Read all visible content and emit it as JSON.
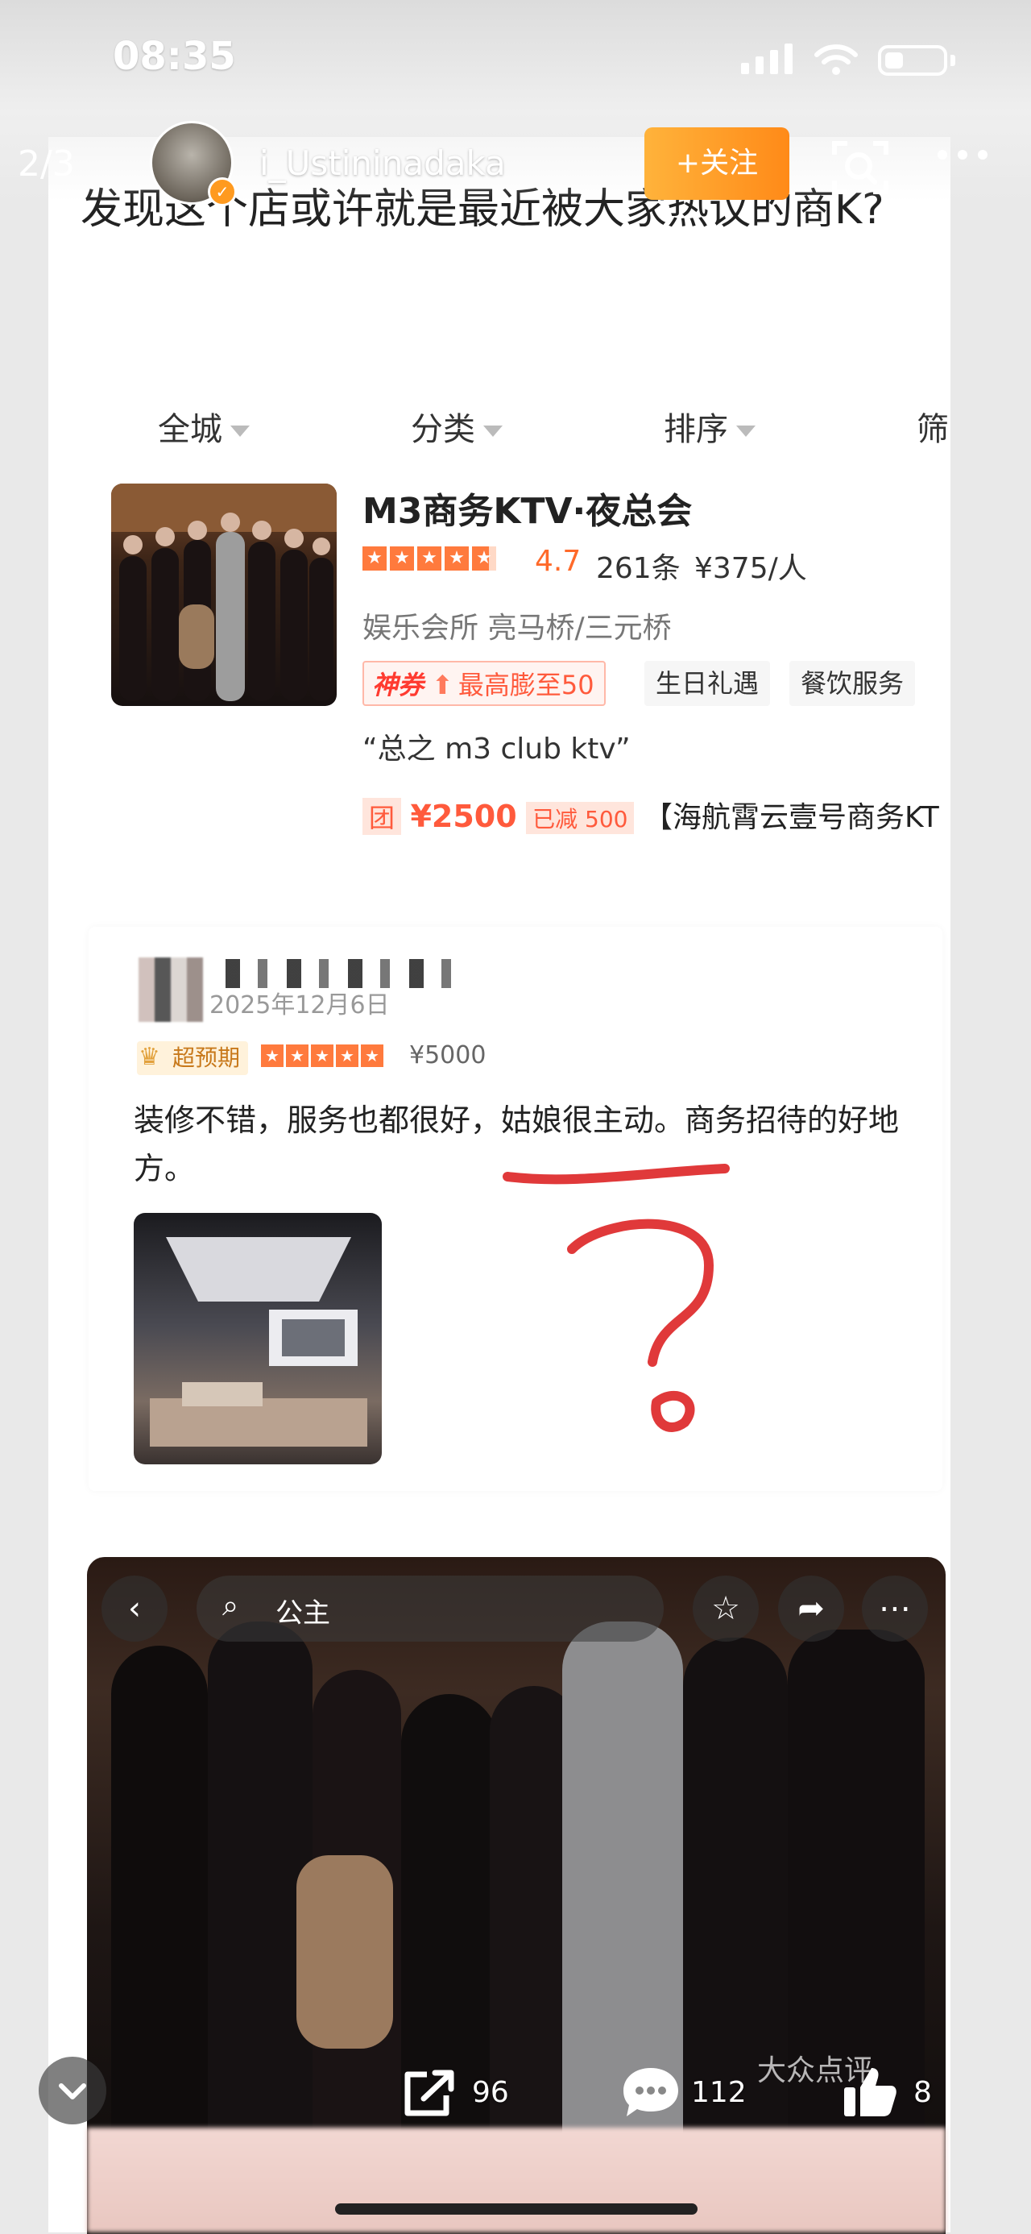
{
  "status_bar": {
    "time": "08:35"
  },
  "header": {
    "page_counter": "2/3",
    "username": "i_Ustininadaka",
    "follow_label": "+关注",
    "icons": [
      "scan-icon",
      "more-icon"
    ]
  },
  "post": {
    "caption": "发现这个店或许就是最近被大家热议的商K?"
  },
  "filters": [
    "全城",
    "分类",
    "排序",
    "筛"
  ],
  "shop": {
    "name": "M3商务KTV·夜总会",
    "rating": "4.7",
    "reviews": "261条",
    "price": "¥375/人",
    "category": "娱乐会所  亮马桥/三元桥",
    "coupon_brand": "神券",
    "coupon_text": "最高膨至50",
    "tags": [
      "生日礼遇",
      "餐饮服务"
    ],
    "quote": "“总之 m3 club ktv”",
    "deal_tag": "团",
    "deal_price": "¥2500",
    "deal_cut": "已减 500",
    "deal_name": "【海航霄云壹号商务KT"
  },
  "review": {
    "date": "2025年12月6日",
    "badge": "超预期",
    "spend": "¥5000",
    "text": "装修不错，服务也都很好，姑娘很主动。商务招待的好地方。"
  },
  "photo": {
    "search_text": "公主",
    "watermark": "大众点评"
  },
  "actions": {
    "share_count": "96",
    "comment_count": "112",
    "like_count": "8"
  },
  "colors": {
    "accent_orange": "#ff8a18",
    "rating_orange": "#ff6a2a",
    "annotation_red": "#e0393a"
  }
}
